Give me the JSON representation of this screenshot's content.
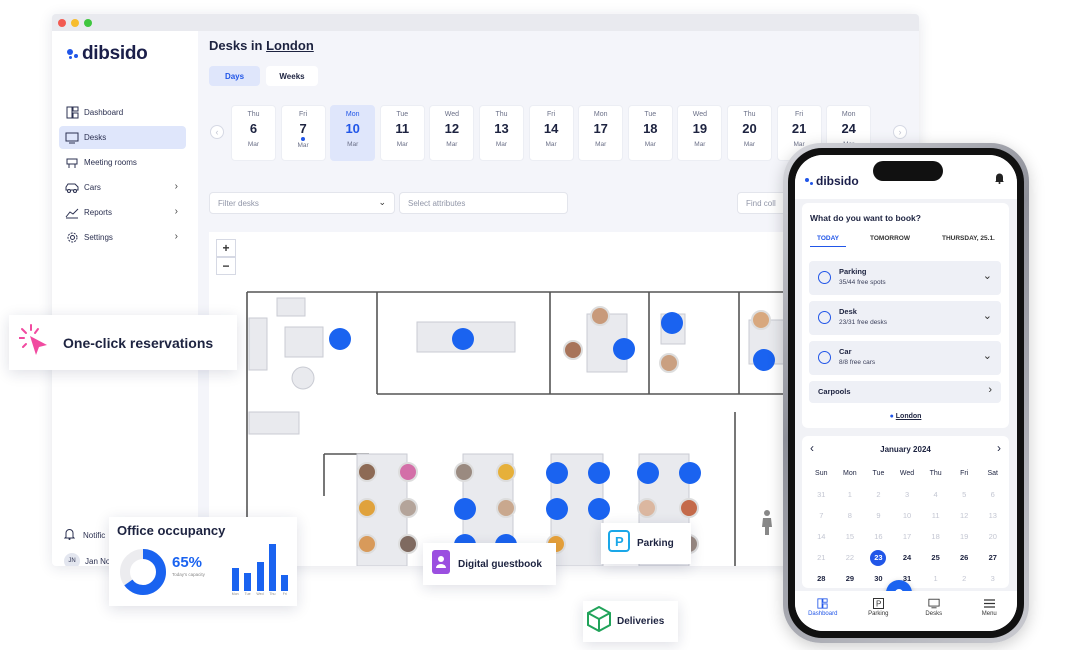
{
  "app": {
    "brand": "dibsido",
    "accent": "#2156e8",
    "nav": [
      {
        "label": "Dashboard",
        "icon": "dashboard-icon"
      },
      {
        "label": "Desks",
        "icon": "desk-monitor-icon",
        "active": true
      },
      {
        "label": "Meeting rooms",
        "icon": "meeting-room-icon"
      },
      {
        "label": "Cars",
        "icon": "car-icon",
        "expandable": true
      },
      {
        "label": "Reports",
        "icon": "chart-icon",
        "expandable": true
      },
      {
        "label": "Settings",
        "icon": "gear-icon",
        "expandable": true
      }
    ],
    "notifications_label": "Notific",
    "user_initials": "JN",
    "user_name": "Jan No"
  },
  "main": {
    "title_prefix": "Desks in",
    "city": "London",
    "view_toggle": {
      "days": "Days",
      "weeks": "Weeks"
    },
    "dates": [
      {
        "dow": "Thu",
        "day": "6",
        "mon": "Mar"
      },
      {
        "dow": "Fri",
        "day": "7",
        "mon": "Mar",
        "dot": true
      },
      {
        "dow": "Mon",
        "day": "10",
        "mon": "Mar",
        "active": true
      },
      {
        "dow": "Tue",
        "day": "11",
        "mon": "Mar"
      },
      {
        "dow": "Wed",
        "day": "12",
        "mon": "Mar"
      },
      {
        "dow": "Thu",
        "day": "13",
        "mon": "Mar"
      },
      {
        "dow": "Fri",
        "day": "14",
        "mon": "Mar"
      },
      {
        "dow": "Mon",
        "day": "17",
        "mon": "Mar"
      },
      {
        "dow": "Tue",
        "day": "18",
        "mon": "Mar"
      },
      {
        "dow": "Wed",
        "day": "19",
        "mon": "Mar"
      },
      {
        "dow": "Thu",
        "day": "20",
        "mon": "Mar"
      },
      {
        "dow": "Fri",
        "day": "21",
        "mon": "Mar"
      },
      {
        "dow": "Mon",
        "day": "24",
        "mon": "Mar"
      }
    ],
    "filter_desks_placeholder": "Filter desks",
    "select_attributes_placeholder": "Select attributes",
    "find_colleague_placeholder": "Find coll",
    "zoom_in": "+",
    "zoom_out": "−"
  },
  "badges": {
    "one_click": "One-click reservations",
    "occupancy_title": "Office occupancy",
    "occupancy_percent": "65%",
    "occupancy_caption": "Today's capacity",
    "occupancy_fraction": 0.65,
    "occupancy_bars": [
      {
        "label": "Mon",
        "value": 0.45
      },
      {
        "label": "Tue",
        "value": 0.35
      },
      {
        "label": "Wed",
        "value": 0.55
      },
      {
        "label": "Thu",
        "value": 0.9
      },
      {
        "label": "Fri",
        "value": 0.3
      }
    ],
    "guestbook": "Digital guestbook",
    "parking": "Parking",
    "deliveries": "Deliveries"
  },
  "phone": {
    "brand": "dibsido",
    "question": "What do you want to book?",
    "tabs": [
      "TODAY",
      "TOMORROW",
      "THURSDAY, 25.1."
    ],
    "options": [
      {
        "title": "Parking",
        "sub": "35/44 free spots"
      },
      {
        "title": "Desk",
        "sub": "23/31 free desks"
      },
      {
        "title": "Car",
        "sub": "8/8 free cars"
      }
    ],
    "carpools": "Carpools",
    "location": "London",
    "calendar_title": "January 2024",
    "weekdays": [
      "Sun",
      "Mon",
      "Tue",
      "Wed",
      "Thu",
      "Fri",
      "Sat"
    ],
    "weeks": [
      [
        "31",
        "1",
        "2",
        "3",
        "4",
        "5",
        "6"
      ],
      [
        "7",
        "8",
        "9",
        "10",
        "11",
        "12",
        "13"
      ],
      [
        "14",
        "15",
        "16",
        "17",
        "18",
        "19",
        "20"
      ],
      [
        "21",
        "22",
        "23",
        "24",
        "25",
        "26",
        "27"
      ],
      [
        "28",
        "29",
        "30",
        "31",
        "1",
        "2",
        "3"
      ]
    ],
    "selected_day": "23",
    "bottom_tabs": [
      "Dashboard",
      "Parking",
      "Desks",
      "Menu"
    ]
  }
}
